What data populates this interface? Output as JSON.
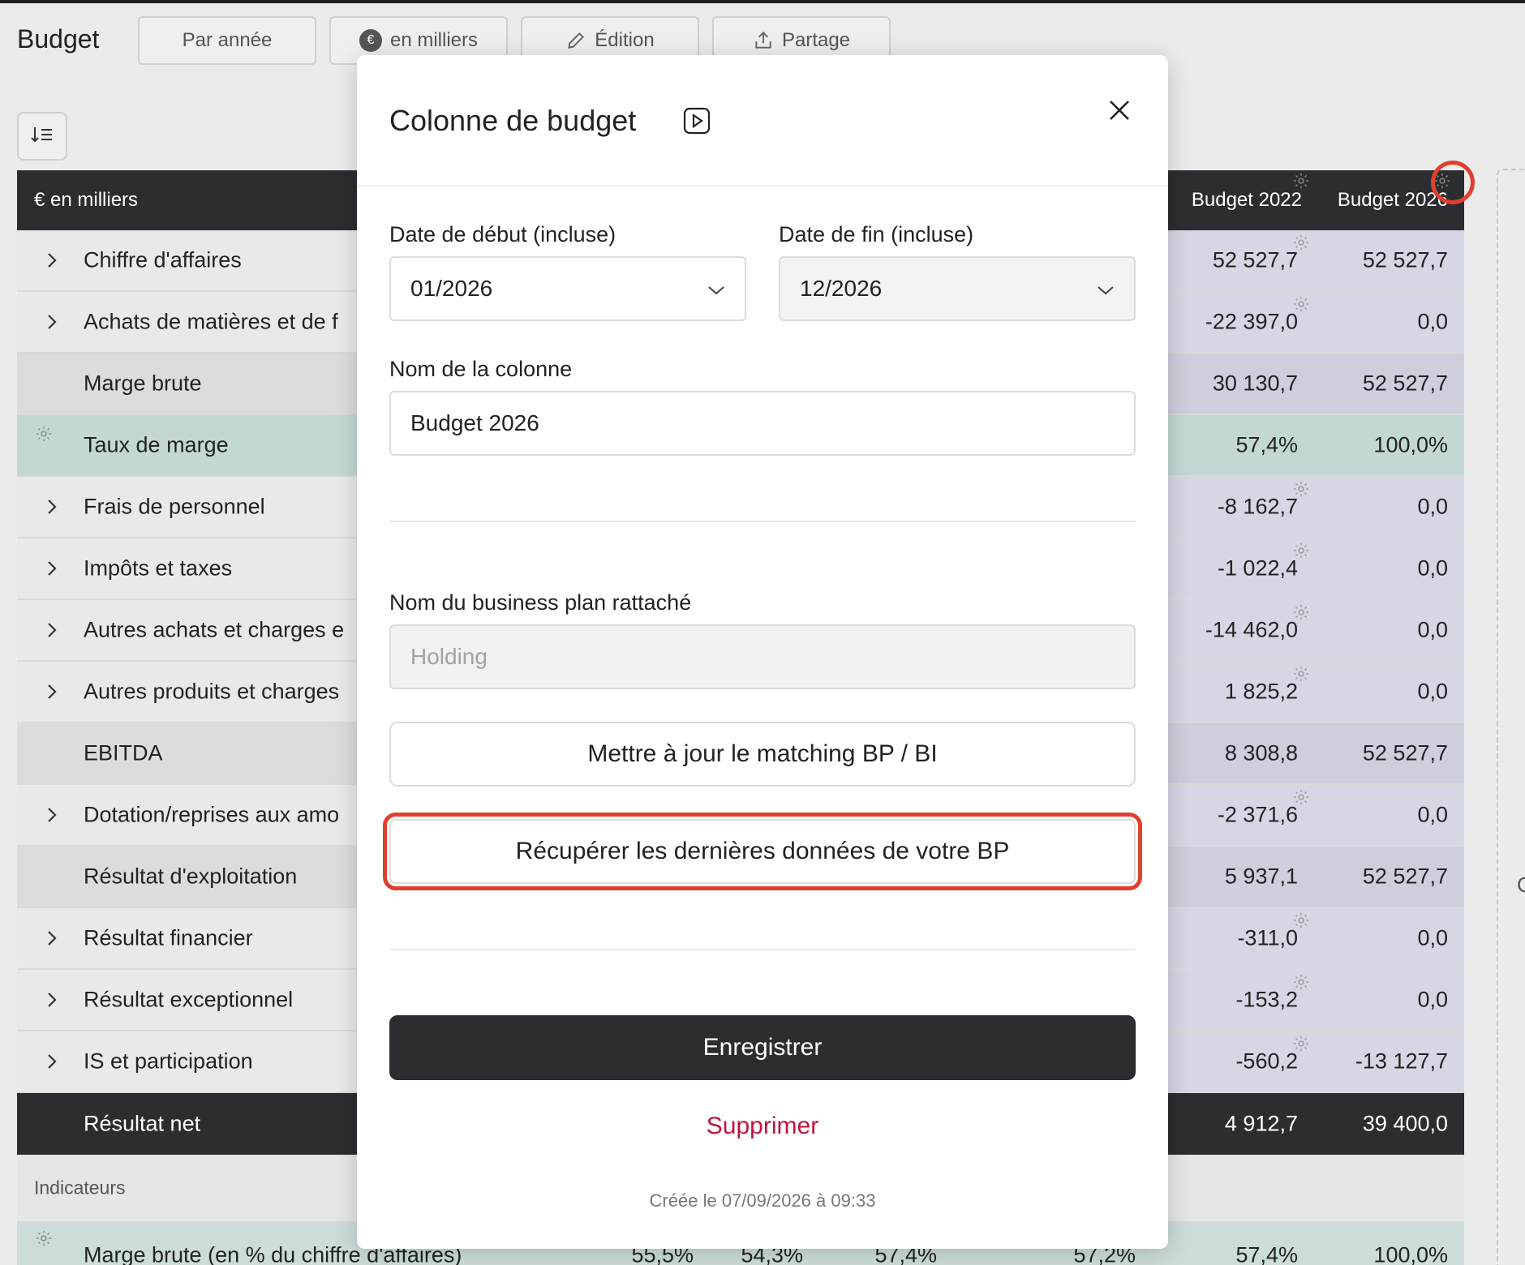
{
  "app": {
    "title": "Budget"
  },
  "toolbar": {
    "period_label": "Par année",
    "unit_label": "en milliers",
    "unit_badge": "€",
    "edit_label": "Édition",
    "share_label": "Partage"
  },
  "table": {
    "header": {
      "label": "€ en milliers",
      "col_b22": "Budget 2022",
      "col_b26": "Budget 2026"
    },
    "rows": [
      {
        "label": "Chiffre d'affaires",
        "b22": "52 527,7",
        "b26": "52 527,7"
      },
      {
        "label": "Achats de matières et de f",
        "b22": "-22 397,0",
        "b26": "0,0"
      },
      {
        "label": "Marge brute",
        "b22": "30 130,7",
        "b26": "52 527,7"
      },
      {
        "label": "Taux de marge",
        "b22": "57,4%",
        "b26": "100,0%"
      },
      {
        "label": "Frais de personnel",
        "b22": "-8 162,7",
        "b26": "0,0"
      },
      {
        "label": "Impôts et taxes",
        "b22": "-1 022,4",
        "b26": "0,0"
      },
      {
        "label": "Autres achats et charges e",
        "b22": "-14 462,0",
        "b26": "0,0"
      },
      {
        "label": "Autres produits et charges",
        "b22": "1 825,2",
        "b26": "0,0"
      },
      {
        "label": "EBITDA",
        "b22": "8 308,8",
        "b26": "52 527,7"
      },
      {
        "label": "Dotation/reprises aux amo",
        "b22": "-2 371,6",
        "b26": "0,0"
      },
      {
        "label": "Résultat d'exploitation",
        "b22": "5 937,1",
        "b26": "52 527,7"
      },
      {
        "label": "Résultat financier",
        "b22": "-311,0",
        "b26": "0,0"
      },
      {
        "label": "Résultat exceptionnel",
        "b22": "-153,2",
        "b26": "0,0"
      },
      {
        "label": "IS et participation",
        "b22": "-560,2",
        "b26": "-13 127,7"
      },
      {
        "label": "Résultat net",
        "b22": "4 912,7",
        "b26": "39 400,0"
      }
    ],
    "section_label": "Indicateurs",
    "indicator": {
      "label": "Marge brute (en % du chiffre d'affaires)",
      "v1": "55,5%",
      "v2": "54,3%",
      "v3": "57,4%",
      "v4": "57,2%",
      "b22": "57,4%",
      "b26": "100,0%"
    }
  },
  "side": {
    "char": "C"
  },
  "modal": {
    "title": "Colonne de budget",
    "start_label": "Date de début (incluse)",
    "start_value": "01/2026",
    "end_label": "Date de fin (incluse)",
    "end_value": "12/2026",
    "name_label": "Nom de la colonne",
    "name_value": "Budget 2026",
    "bp_label": "Nom du business plan rattaché",
    "bp_placeholder": "Holding",
    "update_matching": "Mettre à jour le matching BP / BI",
    "fetch_latest": "Récupérer les dernières données de votre BP",
    "save": "Enregistrer",
    "delete": "Supprimer",
    "created": "Créée le 07/09/2026 à 09:33"
  },
  "colors": {
    "accent_red": "#e0402e",
    "dark": "#2c2d30",
    "danger": "#c0143c",
    "teal_row": "#c3d8d5"
  }
}
